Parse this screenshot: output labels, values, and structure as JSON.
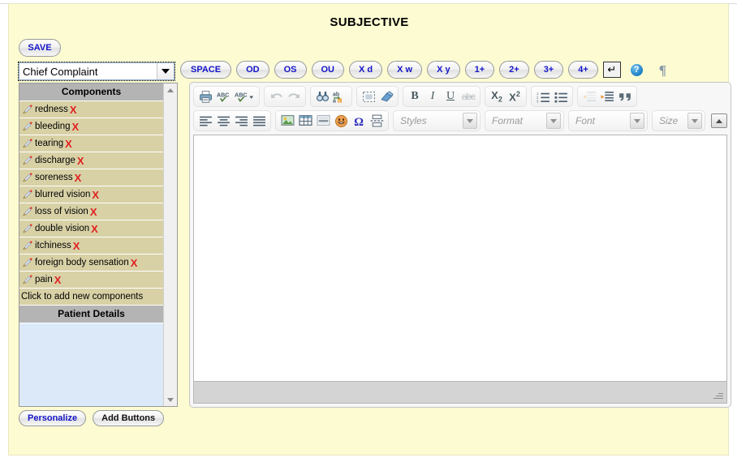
{
  "page": {
    "title": "SUBJECTIVE",
    "background_color": "#fcfbd2"
  },
  "actions": {
    "save_label": "SAVE"
  },
  "section_select": {
    "value": "Chief Complaint",
    "icon": "chevron-down-icon"
  },
  "quick_buttons": [
    {
      "label": "SPACE"
    },
    {
      "label": "OD"
    },
    {
      "label": "OS"
    },
    {
      "label": "OU"
    },
    {
      "label": "X d"
    },
    {
      "label": "X w"
    },
    {
      "label": "X y"
    },
    {
      "label": "1+"
    },
    {
      "label": "2+"
    },
    {
      "label": "3+"
    },
    {
      "label": "4+"
    }
  ],
  "quick_extras": {
    "enter_label": "↵",
    "help_label": "?",
    "pilcrow_label": "¶"
  },
  "components_panel": {
    "header": "Components",
    "items": [
      {
        "label": "redness",
        "remove": "X"
      },
      {
        "label": "bleeding",
        "remove": "X"
      },
      {
        "label": "tearing",
        "remove": "X"
      },
      {
        "label": "discharge",
        "remove": "X"
      },
      {
        "label": "soreness",
        "remove": "X"
      },
      {
        "label": "blurred vision",
        "remove": "X"
      },
      {
        "label": "loss of vision",
        "remove": "X"
      },
      {
        "label": "double vision",
        "remove": "X"
      },
      {
        "label": "itchiness",
        "remove": "X"
      },
      {
        "label": "foreign body sensation",
        "remove": "X"
      },
      {
        "label": "pain",
        "remove": "X"
      }
    ],
    "add_new_label": "Click to add new components",
    "patient_details_header": "Patient Details",
    "colors": {
      "header_bg": "#b4b4b4",
      "row_bg": "#d8d1a6",
      "details_bg": "#dce9f9",
      "remove_color": "#e02020"
    }
  },
  "bottom_buttons": [
    {
      "label": "Personalize",
      "color": "#1414c8"
    },
    {
      "label": "Add Buttons",
      "color": "#101010"
    }
  ],
  "editor": {
    "toolbar_row1": [
      {
        "group": [
          {
            "name": "print-icon",
            "label": "print"
          },
          {
            "name": "spellcheck-icon",
            "label": "ABC"
          },
          {
            "name": "spellcheck-menu-icon",
            "label": "ABC"
          }
        ]
      },
      {
        "group": [
          {
            "name": "undo-icon",
            "label": "undo",
            "disabled": true
          },
          {
            "name": "redo-icon",
            "label": "redo",
            "disabled": true
          }
        ]
      },
      {
        "group": [
          {
            "name": "find-icon",
            "label": "find"
          },
          {
            "name": "replace-icon",
            "label": "replace"
          }
        ]
      },
      {
        "group": [
          {
            "name": "select-all-icon",
            "label": "select all"
          },
          {
            "name": "remove-format-icon",
            "label": "remove format"
          }
        ]
      },
      {
        "group": [
          {
            "name": "bold-icon",
            "label": "B"
          },
          {
            "name": "italic-icon",
            "label": "I"
          },
          {
            "name": "underline-icon",
            "label": "U"
          },
          {
            "name": "strikethrough-icon",
            "label": "abc"
          }
        ]
      },
      {
        "group": [
          {
            "name": "subscript-icon",
            "label": "X2"
          },
          {
            "name": "superscript-icon",
            "label": "X2"
          }
        ]
      },
      {
        "group": [
          {
            "name": "numbered-list-icon",
            "label": "numbered list"
          },
          {
            "name": "bulleted-list-icon",
            "label": "bulleted list"
          }
        ]
      },
      {
        "group": [
          {
            "name": "outdent-icon",
            "label": "outdent",
            "disabled": true
          },
          {
            "name": "indent-icon",
            "label": "indent"
          },
          {
            "name": "blockquote-icon",
            "label": "”"
          }
        ]
      }
    ],
    "toolbar_row2": [
      {
        "group": [
          {
            "name": "align-left-icon",
            "label": "align left"
          },
          {
            "name": "align-center-icon",
            "label": "align center"
          },
          {
            "name": "align-right-icon",
            "label": "align right"
          },
          {
            "name": "align-justify-icon",
            "label": "justify"
          }
        ]
      },
      {
        "group": [
          {
            "name": "image-icon",
            "label": "image"
          },
          {
            "name": "table-icon",
            "label": "table"
          },
          {
            "name": "horizontal-rule-icon",
            "label": "horizontal rule"
          },
          {
            "name": "smiley-icon",
            "label": "smiley"
          },
          {
            "name": "special-char-icon",
            "label": "Ω"
          },
          {
            "name": "page-break-icon",
            "label": "page break"
          }
        ]
      }
    ],
    "combos": [
      {
        "name": "styles-combo",
        "placeholder": "Styles"
      },
      {
        "name": "format-combo",
        "placeholder": "Format"
      },
      {
        "name": "font-combo",
        "placeholder": "Font"
      },
      {
        "name": "size-combo",
        "placeholder": "Size"
      }
    ],
    "content": "",
    "collapse_label": "collapse toolbar"
  }
}
